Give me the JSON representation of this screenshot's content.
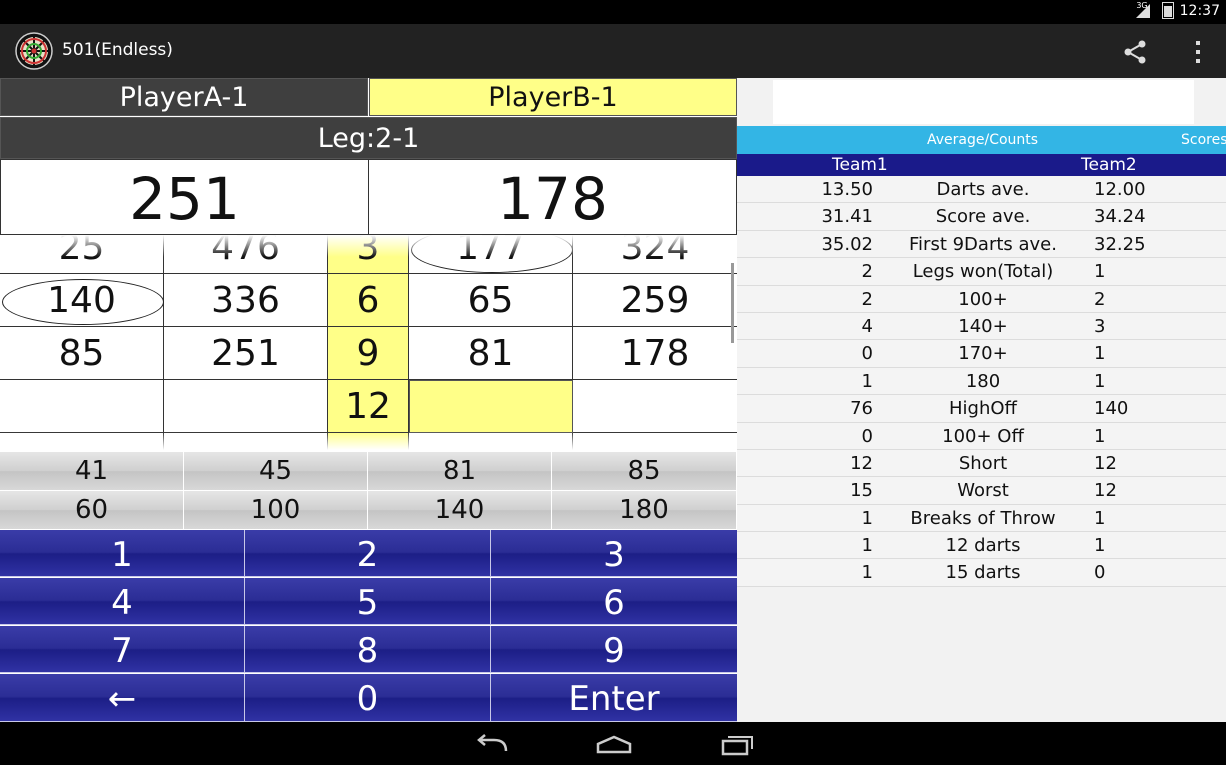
{
  "status_bar": {
    "time": "12:37",
    "network": "3G"
  },
  "app": {
    "title": "501(Endless)"
  },
  "players": {
    "a": "PlayerA-1",
    "b": "PlayerB-1"
  },
  "leg": "Leg:2-1",
  "scores": {
    "a": "251",
    "b": "178"
  },
  "score_rows": [
    [
      "25",
      "476",
      "3",
      "177",
      "324"
    ],
    [
      "140",
      "336",
      "6",
      "65",
      "259"
    ],
    [
      "85",
      "251",
      "9",
      "81",
      "178"
    ],
    [
      "",
      "",
      "12",
      "",
      ""
    ]
  ],
  "quick_scores": [
    [
      "41",
      "45",
      "81",
      "85"
    ],
    [
      "60",
      "100",
      "140",
      "180"
    ]
  ],
  "keypad": [
    [
      "1",
      "2",
      "3"
    ],
    [
      "4",
      "5",
      "6"
    ],
    [
      "7",
      "8",
      "9"
    ],
    [
      "←",
      "0",
      "Enter"
    ]
  ],
  "tabs": {
    "active": "Average/Counts",
    "next": "Scores"
  },
  "teams": {
    "t1": "Team1",
    "t2": "Team2"
  },
  "stats": [
    {
      "v1": "13.50",
      "label": "Darts ave.",
      "v2": "12.00"
    },
    {
      "v1": "31.41",
      "label": "Score ave.",
      "v2": "34.24"
    },
    {
      "v1": "35.02",
      "label": "First 9Darts ave.",
      "v2": "32.25"
    },
    {
      "v1": "2",
      "label": "Legs won(Total)",
      "v2": "1"
    },
    {
      "v1": "2",
      "label": "100+",
      "v2": "2"
    },
    {
      "v1": "4",
      "label": "140+",
      "v2": "3"
    },
    {
      "v1": "0",
      "label": "170+",
      "v2": "1"
    },
    {
      "v1": "1",
      "label": "180",
      "v2": "1"
    },
    {
      "v1": "76",
      "label": "HighOff",
      "v2": "140"
    },
    {
      "v1": "0",
      "label": "100+ Off",
      "v2": "1"
    },
    {
      "v1": "12",
      "label": "Short",
      "v2": "12"
    },
    {
      "v1": "15",
      "label": "Worst",
      "v2": "12"
    },
    {
      "v1": "1",
      "label": "Breaks of Throw",
      "v2": "1"
    },
    {
      "v1": "1",
      "label": "12 darts",
      "v2": "1"
    },
    {
      "v1": "1",
      "label": "15 darts",
      "v2": "0"
    }
  ]
}
